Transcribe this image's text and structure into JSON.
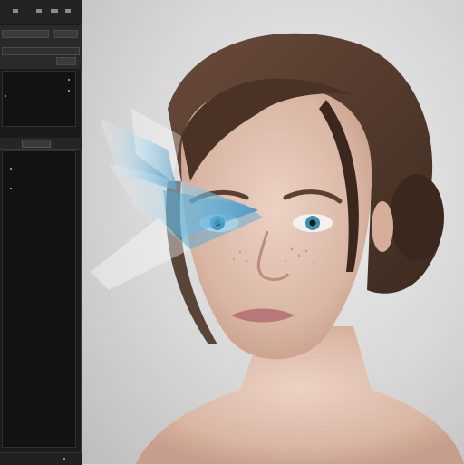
{
  "app": {
    "panel": {
      "topbar_icons": [
        "menu-icon",
        "layers-icon",
        "settings-icon",
        "close-icon"
      ],
      "tab_label": ""
    }
  },
  "canvas": {
    "subject": "portrait"
  },
  "colors": {
    "panel_bg": "#1b1b1b",
    "panel_border": "#3a3a3a",
    "canvas_bg": "#d9d9d9",
    "hair": "#4a3326",
    "skin": "#e2c2b0",
    "eye": "#3f8fae",
    "glass": "#4aa8d8"
  }
}
